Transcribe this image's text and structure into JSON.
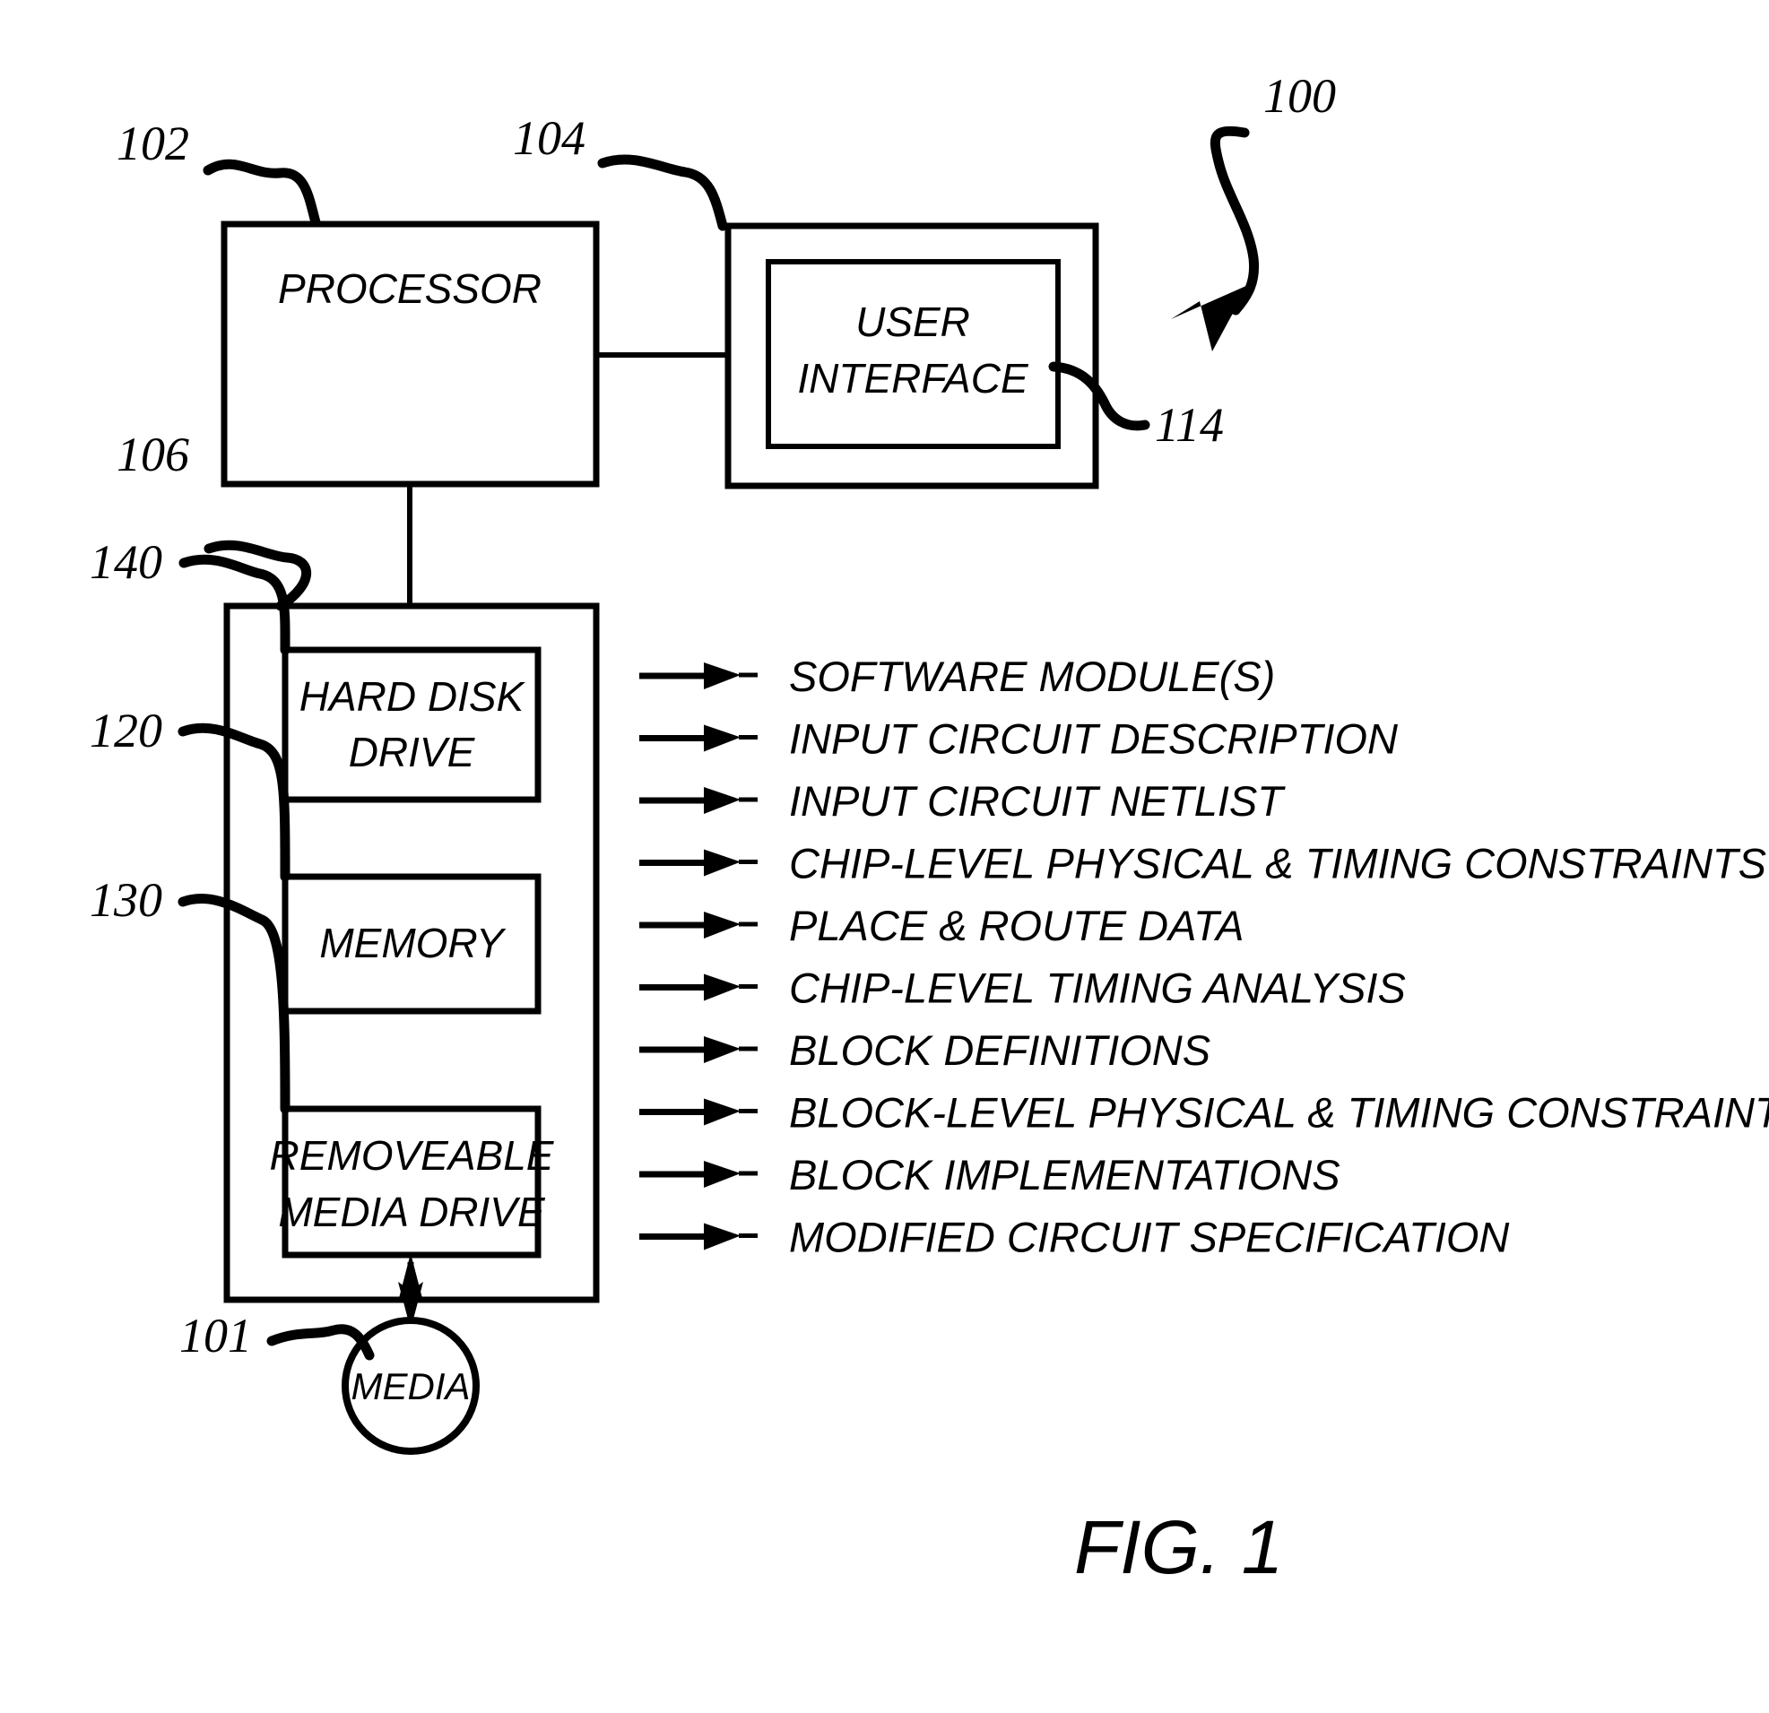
{
  "figure": {
    "label": "FIG. 1",
    "system_ref": "100"
  },
  "blocks": [
    {
      "id": "processor",
      "ref": "102",
      "label": "PROCESSOR"
    },
    {
      "id": "user-interface",
      "ref": "104",
      "inner_ref": "114",
      "label_line1": "USER",
      "label_line2": "INTERFACE"
    },
    {
      "id": "storage",
      "ref": "106",
      "label": ""
    },
    {
      "id": "hard-disk-drive",
      "ref": "140",
      "label_line1": "HARD DISK",
      "label_line2": "DRIVE"
    },
    {
      "id": "memory",
      "ref": "120",
      "label": "MEMORY"
    },
    {
      "id": "removeable-media-drive",
      "ref": "130",
      "label_line1": "REMOVEABLE",
      "label_line2": "MEDIA DRIVE"
    },
    {
      "id": "media",
      "ref": "101",
      "label": "MEDIA"
    }
  ],
  "data_items": [
    "SOFTWARE MODULE(S)",
    "INPUT CIRCUIT DESCRIPTION",
    "INPUT CIRCUIT NETLIST",
    "CHIP-LEVEL PHYSICAL & TIMING CONSTRAINTS",
    "PLACE & ROUTE DATA",
    "CHIP-LEVEL TIMING ANALYSIS",
    "BLOCK DEFINITIONS",
    "BLOCK-LEVEL PHYSICAL & TIMING CONSTRAINTS",
    "BLOCK IMPLEMENTATIONS",
    "MODIFIED CIRCUIT SPECIFICATION"
  ],
  "colors": {
    "ink": "#000000",
    "paper": "#ffffff"
  }
}
